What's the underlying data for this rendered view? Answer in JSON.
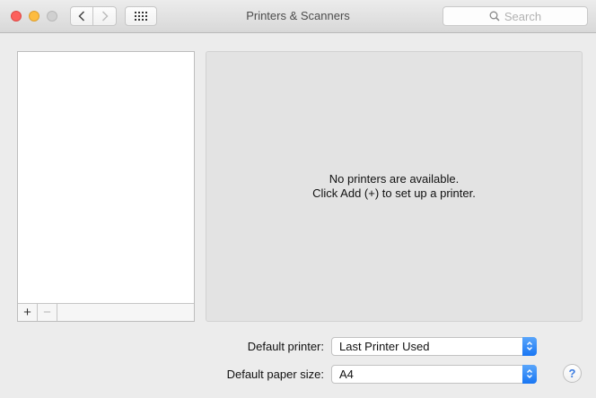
{
  "window": {
    "title": "Printers & Scanners",
    "search_placeholder": "Search"
  },
  "toolbar": {
    "back_icon": "chevron-left-icon",
    "forward_icon": "chevron-right-icon",
    "show_all_icon": "grid-icon"
  },
  "printer_list": {
    "items": [],
    "add_label": "+",
    "remove_label": "−"
  },
  "detail": {
    "line1": "No printers are available.",
    "line2": "Click Add (+) to set up a printer."
  },
  "settings": {
    "default_printer_label": "Default printer:",
    "default_printer_value": "Last Printer Used",
    "paper_size_label": "Default paper size:",
    "paper_size_value": "A4"
  },
  "help": {
    "label": "?"
  },
  "colors": {
    "close": "#fc605c",
    "minimize": "#fdbc40",
    "accent": "#1976f3"
  }
}
